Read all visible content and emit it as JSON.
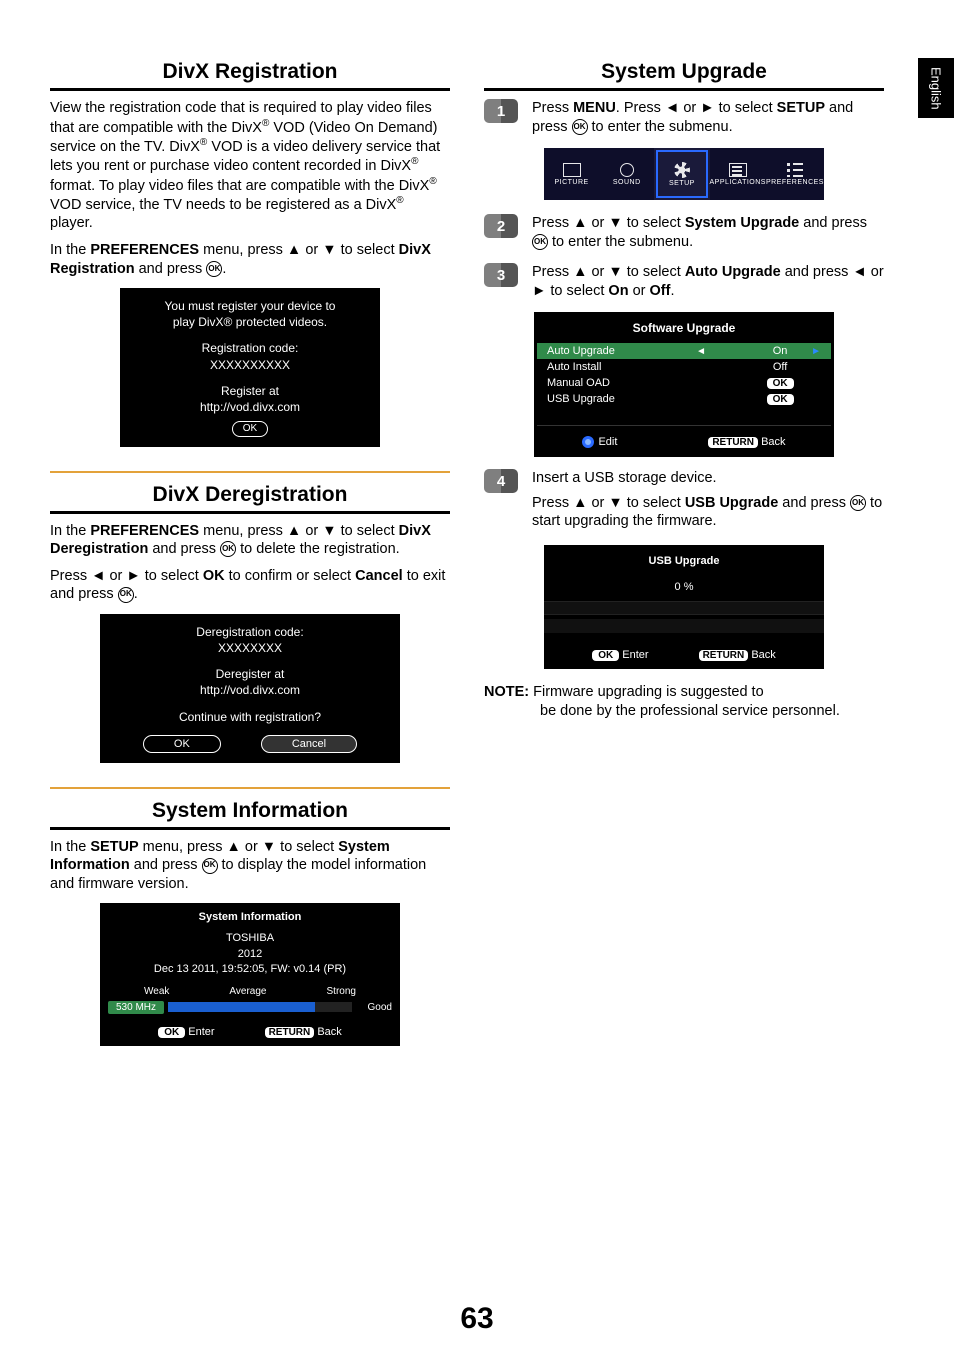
{
  "side_tab": "English",
  "page_number": "63",
  "left": {
    "divx_reg": {
      "title": "DivX Registration",
      "para1_pre": "View the registration code that is required to play video files that are compatible with the DivX",
      "para1_mid": " VOD (Video On Demand) service on the TV. DivX",
      "para1_mid2": " VOD is a video delivery service that lets you rent or purchase video content recorded in DivX",
      "para1_mid3": " format. To play video files that are compatible with the DivX",
      "para1_end": " VOD service, the TV needs to be registered as a DivX",
      "para1_tail": " player.",
      "instr_pre": "In the ",
      "instr_bold1": "PREFERENCES",
      "instr_mid": " menu, press ▲ or ▼ to select ",
      "instr_bold2": "DivX Registration",
      "instr_end": " and press ",
      "panel_line1": "You must register your device to",
      "panel_line2": "play DivX® protected videos.",
      "panel_reg_label": "Registration code:",
      "panel_reg_code": "XXXXXXXXXX",
      "panel_register_at": "Register at",
      "panel_url": "http://vod.divx.com",
      "panel_ok": "OK"
    },
    "divx_dereg": {
      "title": "DivX Deregistration",
      "p1_pre": "In the ",
      "p1_b1": "PREFERENCES",
      "p1_mid": " menu, press ▲ or ▼ to select ",
      "p1_b2": "DivX Deregistration",
      "p1_mid2": " and press ",
      "p1_end": " to delete the registration.",
      "p2_pre": "Press ◄ or ► to select ",
      "p2_b1": "OK",
      "p2_mid": " to confirm or select ",
      "p2_b2": "Cancel",
      "p2_mid2": " to exit and press ",
      "panel_dereg_label": "Deregistration code:",
      "panel_dereg_code": "XXXXXXXX",
      "panel_dereg_at": "Deregister at",
      "panel_url": "http://vod.divx.com",
      "panel_continue": "Continue with registration?",
      "btn_ok": "OK",
      "btn_cancel": "Cancel"
    },
    "sysinfo": {
      "title": "System Information",
      "p_pre": "In the ",
      "p_b1": "SETUP",
      "p_mid": " menu, press ▲ or ▼ to select ",
      "p_b2": "System Information",
      "p_mid2": " and press ",
      "p_end": " to display the model information and firmware version.",
      "panel_title": "System Information",
      "brand": "TOSHIBA",
      "year": "2012",
      "build": "Dec 13 2011, 19:52:05, FW: v0.14 (PR)",
      "weak": "Weak",
      "avg": "Average",
      "strong": "Strong",
      "freq": "530 MHz",
      "good": "Good",
      "enter": "Enter",
      "ok": "OK",
      "ret": "RETURN",
      "back": "Back"
    }
  },
  "right": {
    "title": "System Upgrade",
    "step1_pre": "Press ",
    "step1_b1": "MENU",
    "step1_mid": ". Press ◄ or ► to select ",
    "step1_b2": "SETUP",
    "step1_mid2": " and press ",
    "step1_end": " to enter  the submenu.",
    "menu_items": [
      "PICTURE",
      "SOUND",
      "SETUP",
      "APPLICATIONS",
      "PREFERENCES"
    ],
    "step2_pre": "Press ▲ or ▼ to select ",
    "step2_b1": "System Upgrade",
    "step2_mid": " and press ",
    "step2_end": " to enter the submenu.",
    "step3_pre": "Press ▲ or ▼ to select ",
    "step3_b1": "Auto Upgrade",
    "step3_mid": " and press ◄ or ► to select ",
    "step3_b2": "On",
    "step3_or": " or ",
    "step3_b3": "Off",
    "sw_panel": {
      "title": "Software Upgrade",
      "auto_upgrade": "Auto Upgrade",
      "auto_upgrade_val": "On",
      "auto_install": "Auto Install",
      "auto_install_val": "Off",
      "manual_oad": "Manual OAD",
      "usb_upgrade": "USB Upgrade",
      "ok": "OK",
      "edit": "Edit",
      "ret": "RETURN",
      "back": "Back"
    },
    "step4_line1": "Insert a USB storage device.",
    "step4_pre": "Press ▲ or ▼ to select ",
    "step4_b1": "USB Upgrade",
    "step4_mid": " and press ",
    "step4_end": " to start upgrading the firmware.",
    "usb_panel": {
      "title": "USB Upgrade",
      "pct": "0 %",
      "ok": "OK",
      "enter": "Enter",
      "ret": "RETURN",
      "back": "Back"
    },
    "note_label": "NOTE:",
    "note_text1": " Firmware upgrading is suggested to",
    "note_text2": "be done by the professional service personnel."
  }
}
